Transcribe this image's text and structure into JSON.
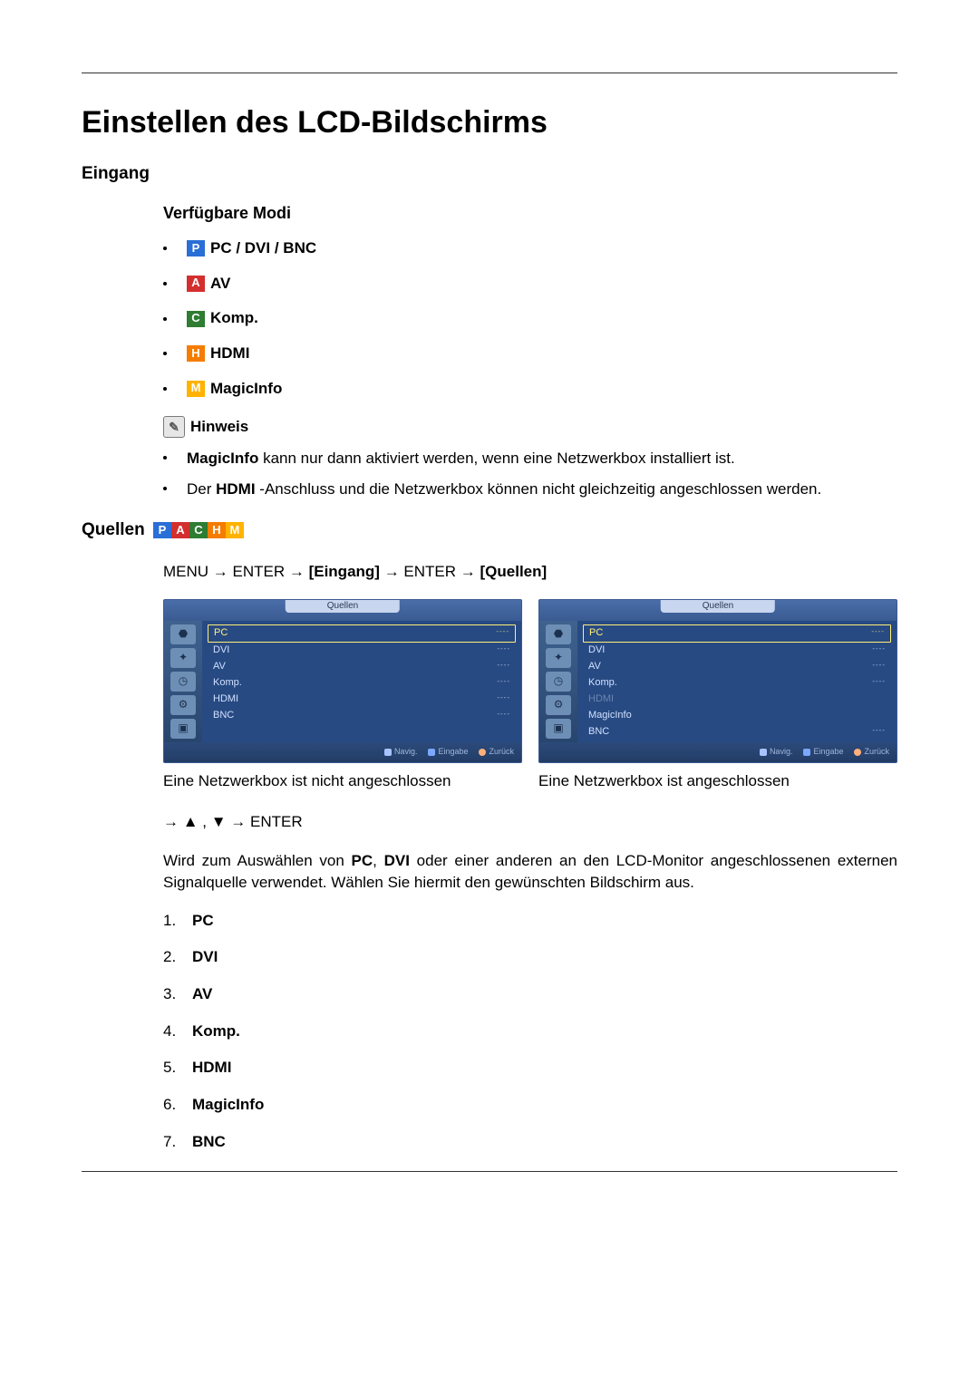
{
  "title": "Einstellen des LCD-Bildschirms",
  "sections": {
    "eingang": {
      "heading": "Eingang",
      "modesHeading": "Verfügbare Modi",
      "modes": [
        {
          "badge": "P",
          "label": "PC / DVI / BNC"
        },
        {
          "badge": "A",
          "label": "AV"
        },
        {
          "badge": "C",
          "label": "Komp."
        },
        {
          "badge": "H",
          "label": "HDMI"
        },
        {
          "badge": "M",
          "label": "MagicInfo"
        }
      ],
      "noteLabel": "Hinweis",
      "notes": {
        "n1_pre": "MagicInfo",
        "n1_post": " kann nur dann aktiviert werden, wenn eine Netzwerkbox installiert ist.",
        "n2_pre": "Der ",
        "n2_mid": "HDMI",
        "n2_post": " -Anschluss und die Netzwerkbox können nicht gleichzeitig angeschlossen werden."
      }
    },
    "quellen": {
      "heading": "Quellen",
      "nav1": "MENU → ENTER → ",
      "nav1_b": "Eingang",
      "nav1_mid": " → ENTER → ",
      "nav1_b2": "Quellen",
      "shotTitle": "Quellen",
      "shotFooter": {
        "nav": "Navig.",
        "enter": "Eingabe",
        "back": "Zurück"
      },
      "shotA": {
        "rows": [
          {
            "name": "PC",
            "val": "----",
            "sel": true
          },
          {
            "name": "DVI",
            "val": "----"
          },
          {
            "name": "AV",
            "val": "----"
          },
          {
            "name": "Komp.",
            "val": "----"
          },
          {
            "name": "HDMI",
            "val": "----"
          },
          {
            "name": "BNC",
            "val": "----"
          }
        ]
      },
      "shotB": {
        "rows": [
          {
            "name": "PC",
            "val": "----",
            "sel": true
          },
          {
            "name": "DVI",
            "val": "----"
          },
          {
            "name": "AV",
            "val": "----"
          },
          {
            "name": "Komp.",
            "val": "----"
          },
          {
            "name": "HDMI",
            "val": "",
            "dim": true
          },
          {
            "name": "MagicInfo",
            "val": ""
          },
          {
            "name": "BNC",
            "val": "----"
          }
        ]
      },
      "captionA": "Eine Netzwerkbox ist nicht angeschlossen",
      "captionB": "Eine Netzwerkbox ist angeschlossen",
      "nav2": "→ ▲ , ▼ → ENTER",
      "desc_pre": "Wird zum Auswählen von ",
      "desc_b1": "PC",
      "desc_mid1": ", ",
      "desc_b2": "DVI",
      "desc_post": " oder einer anderen an den LCD-Monitor angeschlossenen externen Signalquelle verwendet. Wählen Sie hiermit den gewünschten Bildschirm aus.",
      "list": [
        "PC",
        "DVI",
        "AV",
        "Komp.",
        "HDMI",
        "MagicInfo",
        "BNC"
      ]
    }
  }
}
